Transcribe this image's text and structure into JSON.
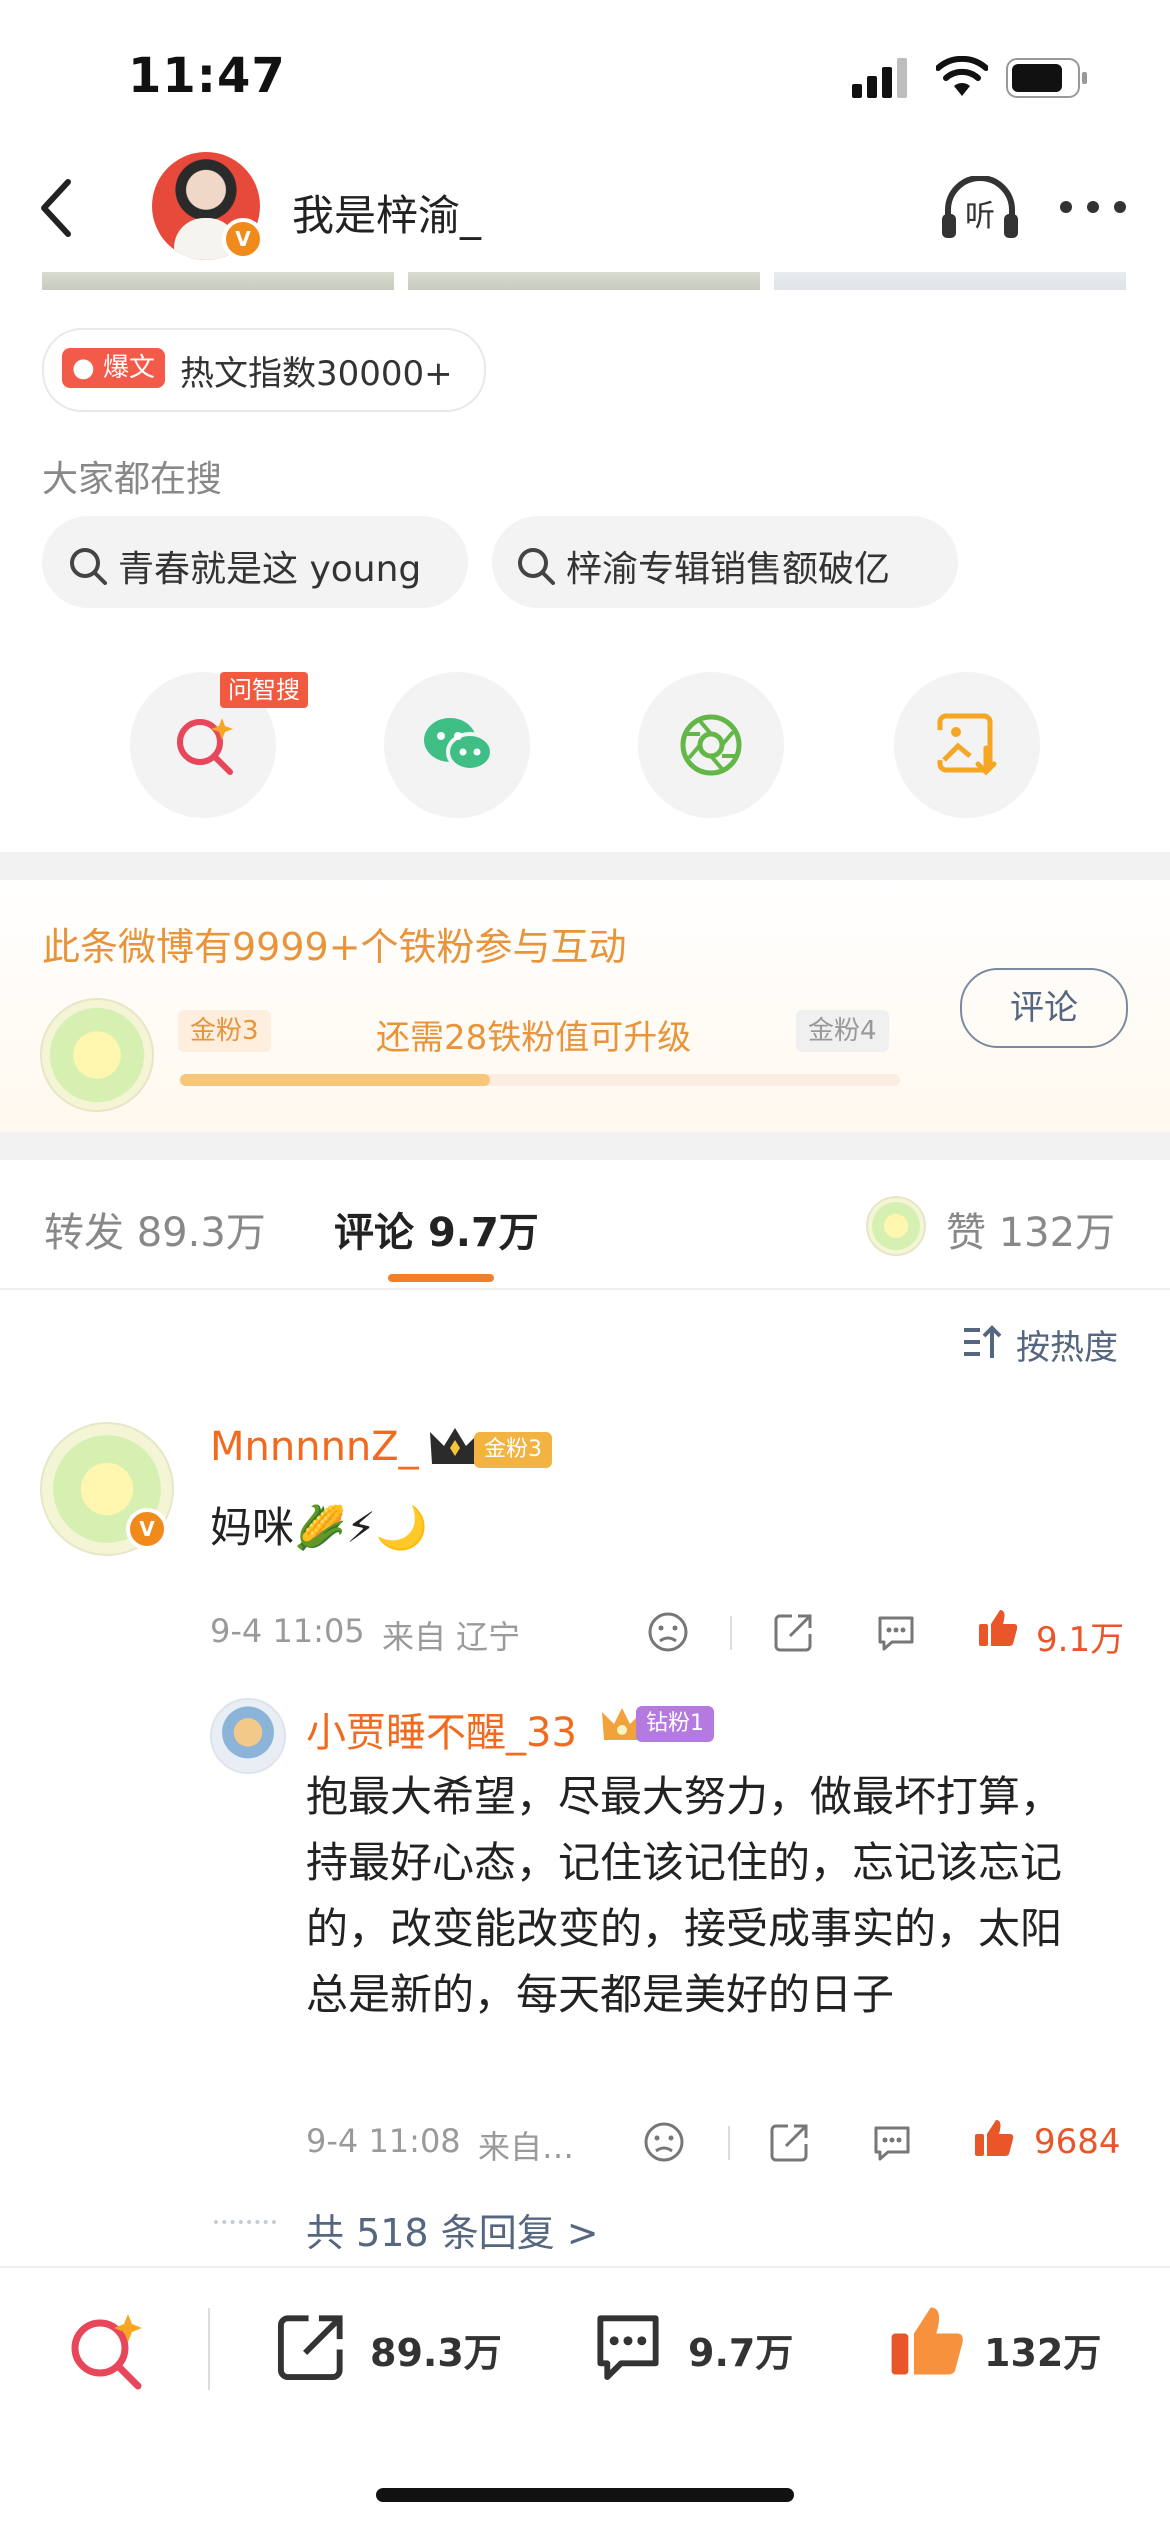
{
  "status_bar": {
    "time": "11:47"
  },
  "header": {
    "title": "我是梓渝_",
    "verified_badge": "V"
  },
  "hot_article": {
    "badge": "爆文",
    "text": "热文指数30000+"
  },
  "search": {
    "heading": "大家都在搜",
    "chips": [
      "青春就是这 young",
      "梓渝专辑销售额破亿"
    ]
  },
  "share": {
    "ask_tag": "问智搜"
  },
  "iron_fans": {
    "title": "此条微博有9999+个铁粉参与互动",
    "current_level": "金粉3",
    "next_level": "金粉4",
    "remaining_text": "还需28铁粉值可升级",
    "progress": 0.43,
    "comment_button": "评论"
  },
  "tabs": {
    "repost_label": "转发",
    "repost_count": "89.3万",
    "comment_label": "评论",
    "comment_count": "9.7万",
    "like_label": "赞",
    "like_count": "132万"
  },
  "sort_label": "按热度",
  "comment": {
    "username": "MnnnnnZ_",
    "medal": "金粉3",
    "text": "妈咪🌽⚡🌙",
    "time": "9-4 11:05",
    "source": "来自 辽宁",
    "likes": "9.1万",
    "reply": {
      "username": "小贾睡不醒_33",
      "medal": "钻粉1",
      "text": "抱最大希望，尽最大努力，做最坏打算，持最好心态，记住该记住的，忘记该忘记的，改变能改变的，接受成事实的，太阳总是新的，每天都是美好的日子",
      "time": "9-4 11:08",
      "source": "来自…",
      "likes": "9684"
    },
    "more_replies": "共 518 条回复 >"
  },
  "bottom_bar": {
    "repost": "89.3万",
    "comment": "9.7万",
    "like": "132万"
  },
  "colors": {
    "accent": "#f06b1f",
    "gold": "#e8943a",
    "link": "#556680"
  }
}
